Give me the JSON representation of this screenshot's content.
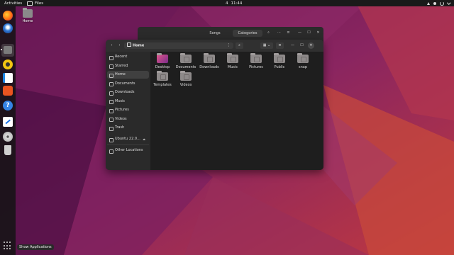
{
  "topbar": {
    "activities": "Activities",
    "app_name": "Files",
    "clock_bell": "4",
    "clock_time": "11:44",
    "system_icons": [
      "network-icon",
      "volume-icon",
      "power-icon",
      "chevron-down-icon"
    ]
  },
  "dock": {
    "items": [
      "firefox",
      "thunderbird",
      "files",
      "rhythmbox",
      "libreoffice-writer",
      "ubuntu-software",
      "help",
      "text-editor",
      "disc",
      "trash"
    ],
    "show_apps_label": "Show Applications"
  },
  "desktop": {
    "home_label": "Home"
  },
  "background_window": {
    "tabs": [
      "Songs",
      "Categories"
    ],
    "search_symbol": "⌕",
    "menu_symbol": "≡",
    "more_symbol": "⋯",
    "min_symbol": "—",
    "max_symbol": "☐",
    "close_symbol": "✕"
  },
  "files_window": {
    "back_symbol": "‹",
    "forward_symbol": "›",
    "path": "Home",
    "path_menu_symbol": "⋮",
    "search_symbol": "⌕",
    "view_symbol": "▦ ⌄",
    "list_symbol": "≡",
    "min_symbol": "—",
    "max_symbol": "☐",
    "close_symbol": "✕",
    "sidebar": [
      {
        "label": "Recent",
        "icon": "clock-icon"
      },
      {
        "label": "Starred",
        "icon": "star-icon"
      },
      {
        "label": "Home",
        "icon": "home-icon",
        "active": true
      },
      {
        "label": "Documents",
        "icon": "document-icon"
      },
      {
        "label": "Downloads",
        "icon": "download-icon"
      },
      {
        "label": "Music",
        "icon": "music-icon"
      },
      {
        "label": "Pictures",
        "icon": "picture-icon"
      },
      {
        "label": "Videos",
        "icon": "video-icon"
      },
      {
        "label": "Trash",
        "icon": "trash-icon"
      },
      {
        "label": "Ubuntu 22.0...",
        "icon": "disc-icon",
        "eject": "⏏"
      },
      {
        "label": "Other Locations",
        "icon": "plus-icon"
      }
    ],
    "folders": [
      "Desktop",
      "Documents",
      "Downloads",
      "Music",
      "Pictures",
      "Public",
      "snap",
      "Templates",
      "Videos"
    ]
  },
  "colors": {
    "wallpaper_base": "#7a1f5a",
    "accent": "#e95420"
  }
}
